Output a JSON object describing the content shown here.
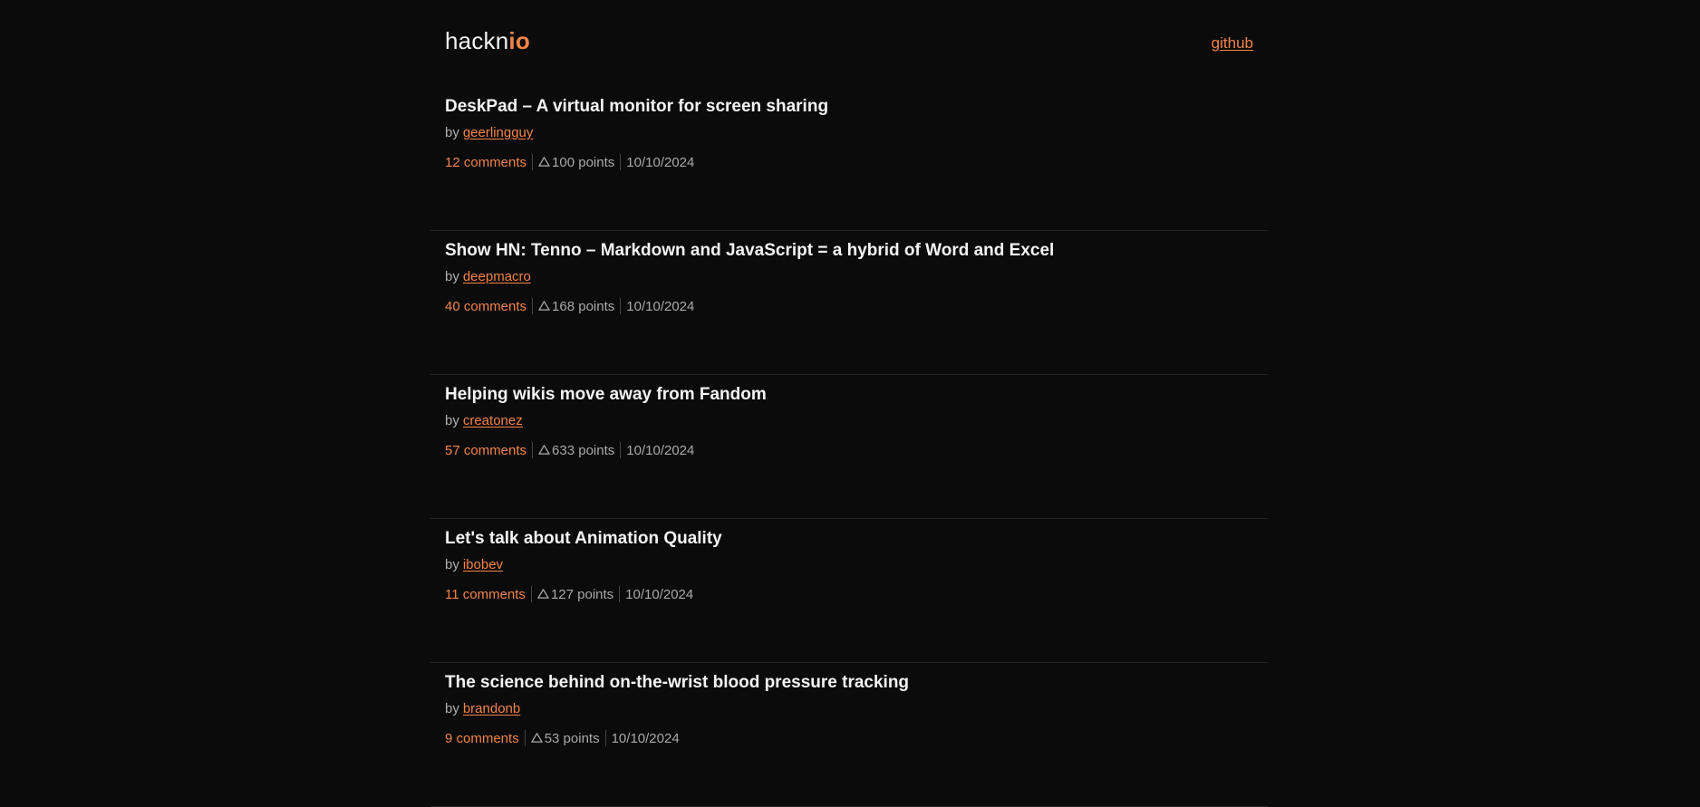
{
  "header": {
    "logo_main": "hackn",
    "logo_accent": "io",
    "github_label": "github"
  },
  "stories": [
    {
      "title": "DeskPad – A virtual monitor for screen sharing",
      "by_label": "by",
      "author": "geerlingguy",
      "comments": "12 comments",
      "points": "100 points",
      "date": "10/10/2024",
      "upvote_icon": "triangle-up-icon"
    },
    {
      "title": "Show HN: Tenno – Markdown and JavaScript = a hybrid of Word and Excel",
      "by_label": "by",
      "author": "deepmacro",
      "comments": "40 comments",
      "points": "168 points",
      "date": "10/10/2024",
      "upvote_icon": "triangle-up-icon"
    },
    {
      "title": "Helping wikis move away from Fandom",
      "by_label": "by",
      "author": "creatonez",
      "comments": "57 comments",
      "points": "633 points",
      "date": "10/10/2024",
      "upvote_icon": "triangle-up-icon"
    },
    {
      "title": "Let's talk about Animation Quality",
      "by_label": "by",
      "author": "ibobev",
      "comments": "11 comments",
      "points": "127 points",
      "date": "10/10/2024",
      "upvote_icon": "triangle-up-icon"
    },
    {
      "title": "The science behind on-the-wrist blood pressure tracking",
      "by_label": "by",
      "author": "brandonb",
      "comments": "9 comments",
      "points": "53 points",
      "date": "10/10/2024",
      "upvote_icon": "triangle-up-icon"
    }
  ],
  "colors": {
    "background": "#0b0b0b",
    "accent": "#f0844a",
    "text": "#f4f4f4",
    "muted": "#a8a8a8",
    "divider": "#242424"
  }
}
